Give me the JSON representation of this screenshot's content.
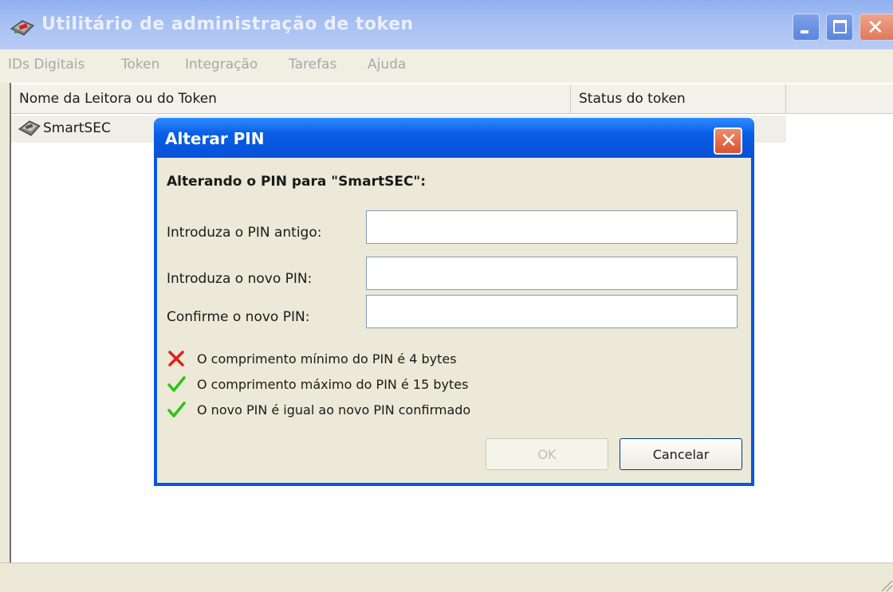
{
  "window": {
    "title": "Utilitário de administração de token"
  },
  "menu": [
    "IDs Digitais",
    "Token",
    "Integração",
    "Tarefas",
    "Ajuda"
  ],
  "list": {
    "columns": [
      "Nome da Leitora ou do Token",
      "Status do token",
      ""
    ],
    "rows": [
      {
        "name": "SmartSEC",
        "status": ""
      }
    ]
  },
  "dialog": {
    "title": "Alterar PIN",
    "heading": "Alterando o PIN para \"SmartSEC\":",
    "fields": [
      {
        "label": "Introduza o PIN antigo:",
        "value": ""
      },
      {
        "label": "Introduza o novo PIN:",
        "value": ""
      },
      {
        "label": "Confirme o novo PIN:",
        "value": ""
      }
    ],
    "rules": [
      {
        "text": "O comprimento mínimo do PIN é 4 bytes",
        "icon": "red-x-icon",
        "status": "fail"
      },
      {
        "text": "O comprimento máximo do PIN é 15 bytes",
        "icon": "green-check-icon",
        "status": "pass"
      },
      {
        "text": "O novo PIN é igual ao novo PIN confirmado",
        "icon": "green-check-icon",
        "status": "pass"
      }
    ],
    "buttons": {
      "ok": "OK",
      "cancel": "Cancelar"
    }
  },
  "colors": {
    "title_bar": "#a4bdf2",
    "dialog_title_bar": "#0a5ee6",
    "fail": "#e0201a",
    "pass": "#2ec414"
  }
}
